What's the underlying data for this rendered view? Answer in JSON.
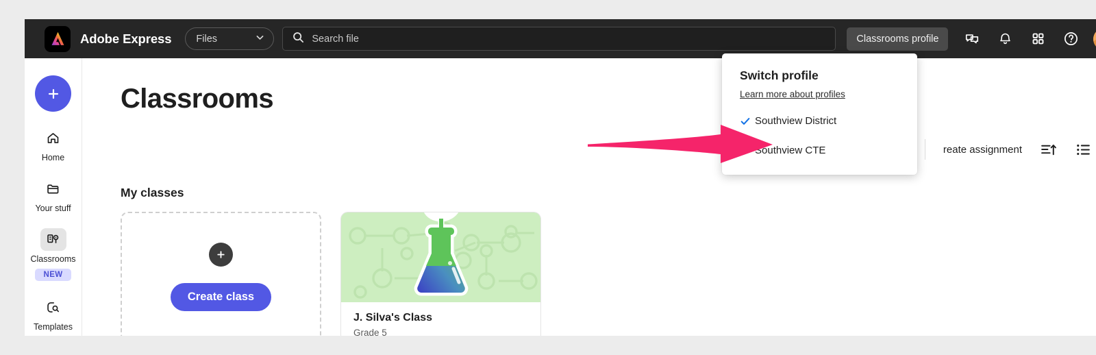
{
  "brand": {
    "name": "Adobe Express",
    "logo_icon": "adobe-express-logo-icon",
    "accent": "#5258e4",
    "topbar_bg": "#262626"
  },
  "topbar": {
    "files_select": {
      "value": "Files",
      "chevron_icon": "chevron-down-icon"
    },
    "search": {
      "placeholder": "Search file",
      "icon": "search-icon"
    },
    "profile_chip": "Classrooms profile",
    "icons": [
      {
        "name": "chat-bubbles-icon"
      },
      {
        "name": "bell-icon"
      },
      {
        "name": "apps-grid-icon"
      },
      {
        "name": "help-circle-icon"
      }
    ],
    "avatar_icon": "user-avatar"
  },
  "sidebar": {
    "new_button": {
      "icon": "plus-icon",
      "label": "New"
    },
    "items": [
      {
        "label": "Home",
        "icon": "home-icon",
        "selected": false,
        "badge": ""
      },
      {
        "label": "Your stuff",
        "icon": "folder-icon",
        "selected": false,
        "badge": ""
      },
      {
        "label": "Classrooms",
        "icon": "classrooms-icon",
        "selected": true,
        "badge": "NEW"
      },
      {
        "label": "Templates",
        "icon": "templates-search-icon",
        "selected": false,
        "badge": ""
      }
    ]
  },
  "main": {
    "page_title": "Classrooms",
    "section_title": "My classes",
    "toolbar": {
      "create_assignment": "reate assignment",
      "sort_icon": "sort-ascending-icon",
      "view_icon": "list-view-icon"
    },
    "create_card": {
      "plus_icon": "plus-icon",
      "button_label": "Create class"
    },
    "classes": [
      {
        "name": "J. Silva's Class",
        "grade": "Grade 5",
        "thumb_icon": "science-flask-sprout-icon",
        "thumb_bg": "#cdeec0"
      }
    ]
  },
  "profile_menu": {
    "title": "Switch profile",
    "link": "Learn more about profiles",
    "check_color": "#1473e6",
    "options": [
      {
        "label": "Southview District",
        "checked": true
      },
      {
        "label": "Southview CTE",
        "checked": false
      }
    ]
  },
  "annotation": {
    "arrow_color": "#f5246a",
    "arrow_icon": "pointer-arrow-right"
  }
}
